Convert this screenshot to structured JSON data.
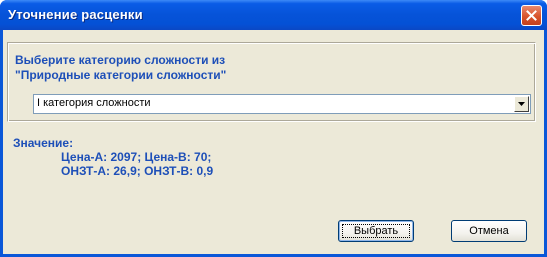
{
  "window": {
    "title": "Уточнение расценки",
    "close_icon": "close-icon"
  },
  "prompt": {
    "line1": "Выберите категорию сложности из",
    "line2": "\"Природные категории сложности\""
  },
  "category_combo": {
    "selected": "I категория сложности"
  },
  "value": {
    "label": "Значение:",
    "line1": "Цена-А: 2097; Цена-В: 70;",
    "line2": "ОНЗТ-А: 26,9; ОНЗТ-В: 0,9"
  },
  "buttons": {
    "select_label": "Выбрать",
    "cancel_label": "Отмена"
  },
  "colors": {
    "titlebar": "#0653d8",
    "text_accent": "#1d4fb8",
    "dialog_bg": "#ece9d8",
    "close_button": "#d8542c"
  }
}
